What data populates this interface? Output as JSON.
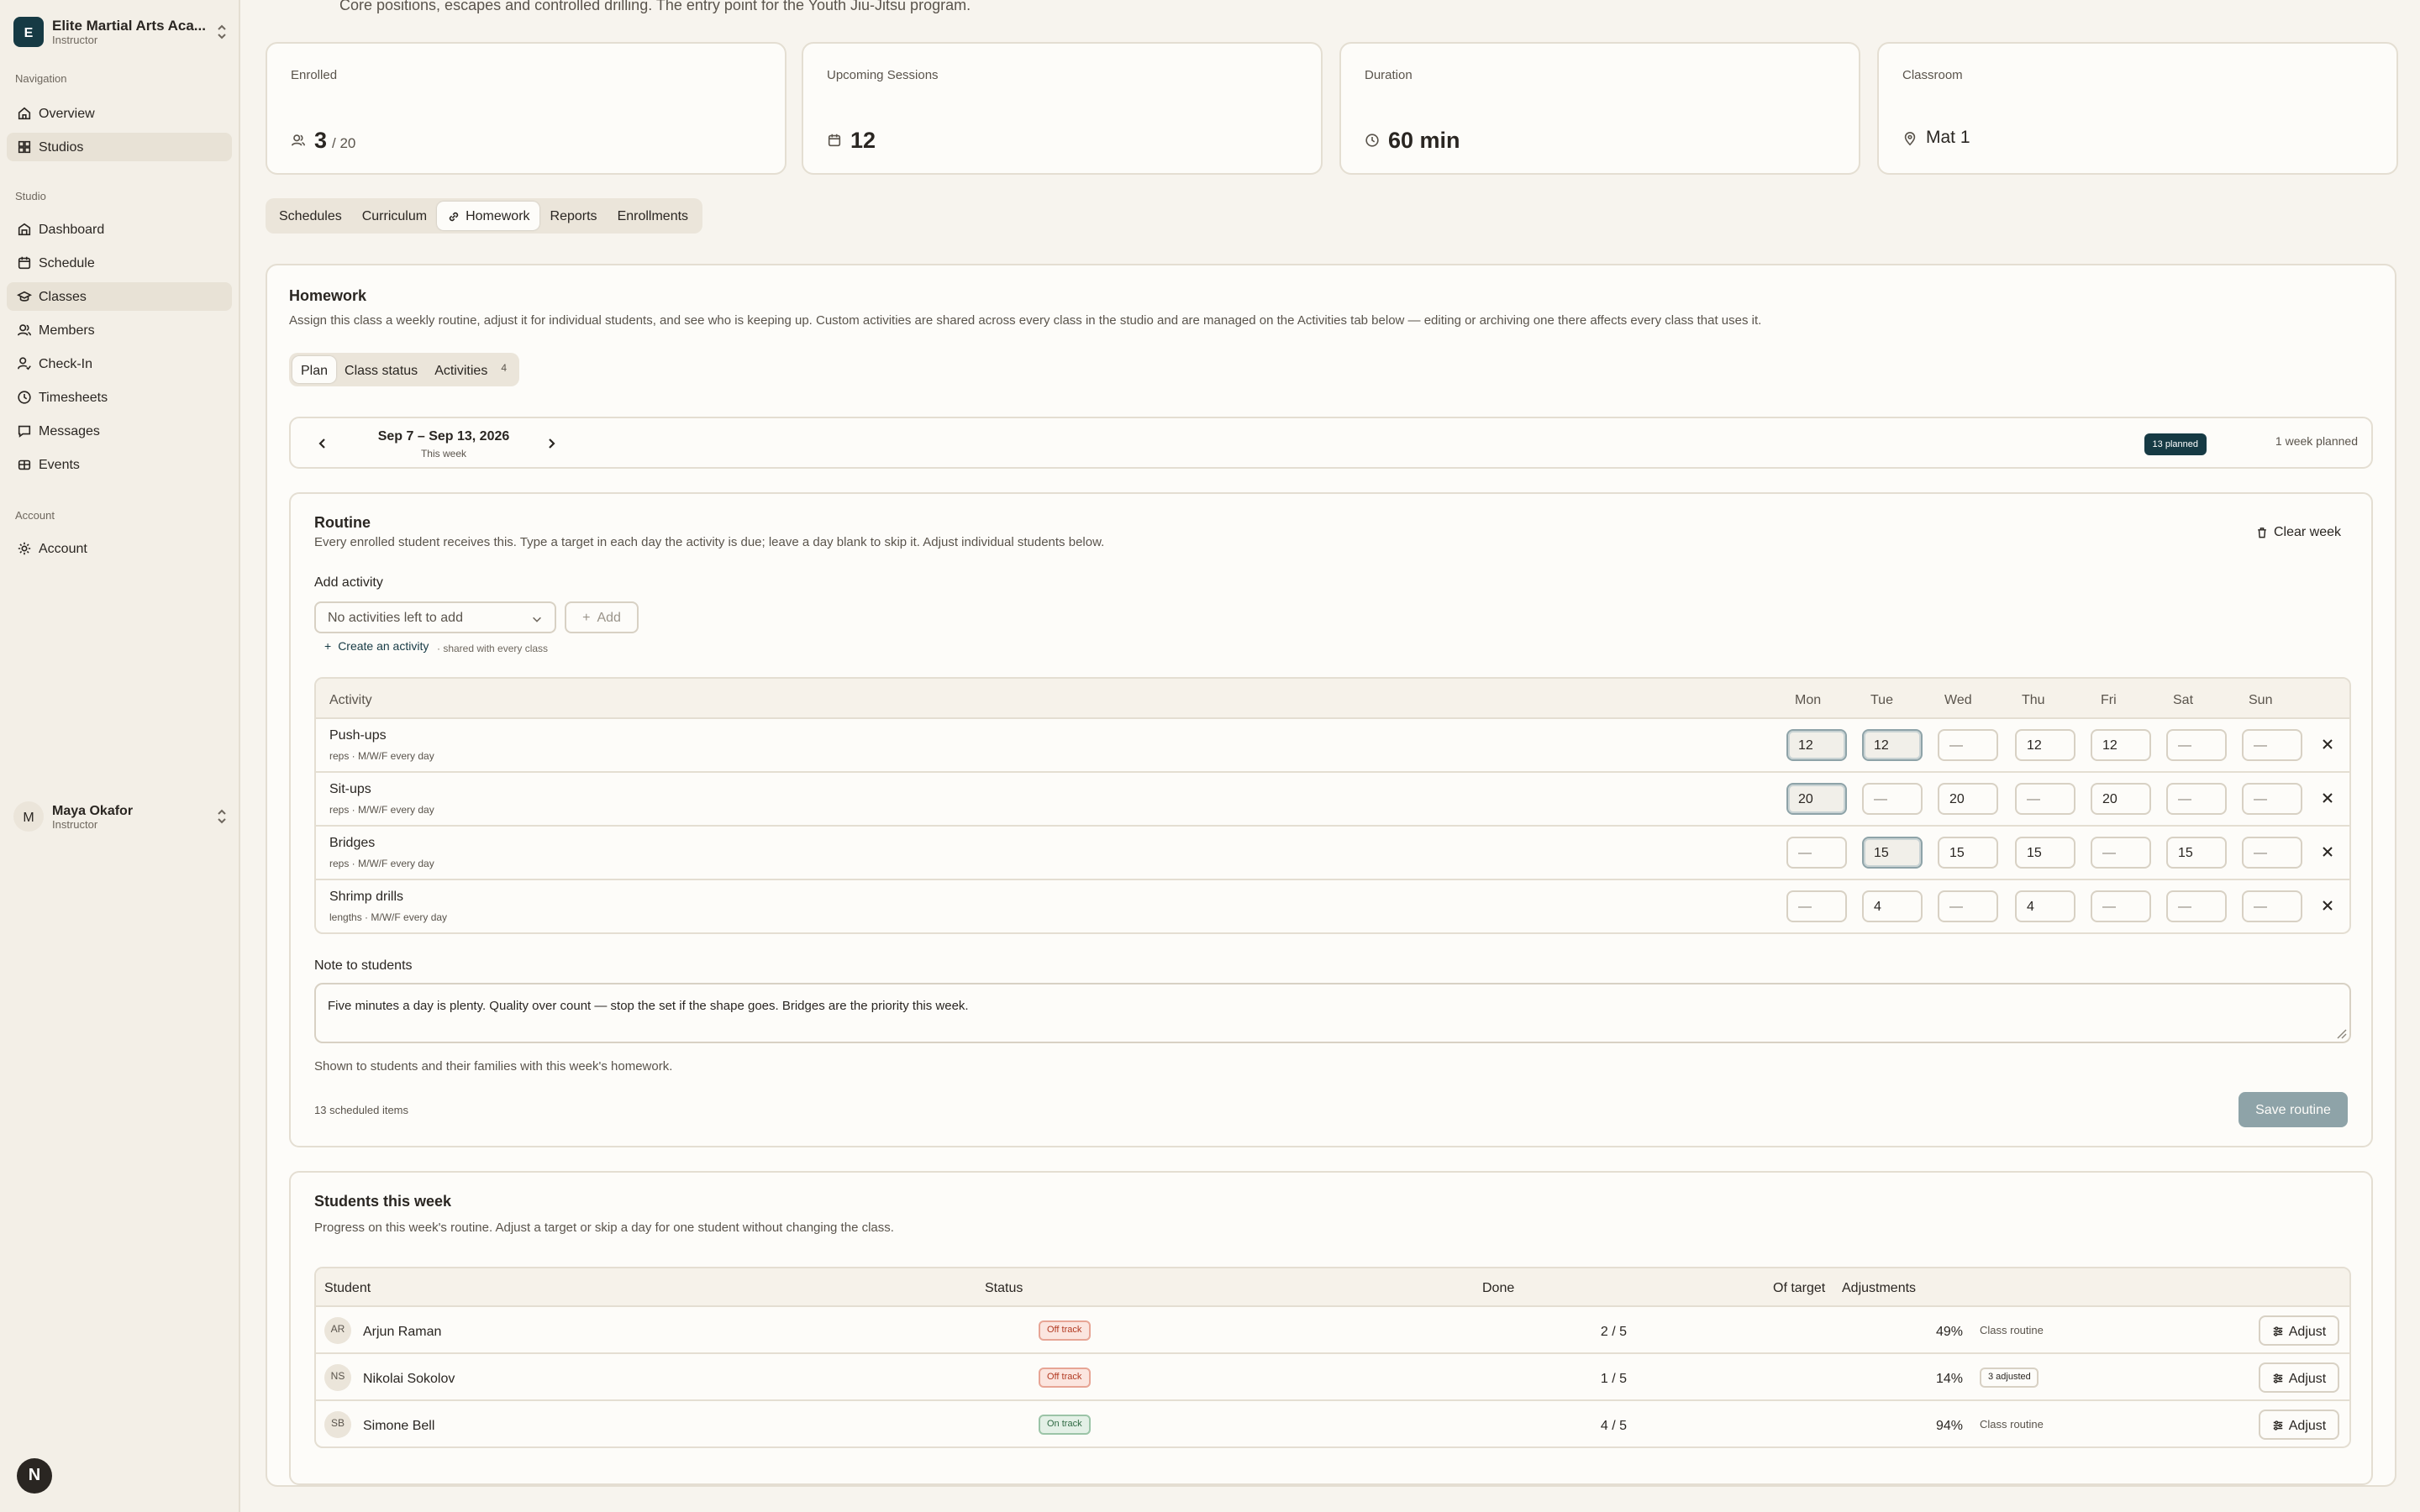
{
  "org": {
    "name": "Elite Martial Arts Aca...",
    "role": "Instructor",
    "logo_letter": "E"
  },
  "sidebar": {
    "section_navigation": "Navigation",
    "section_studio": "Studio",
    "section_account": "Account",
    "nav": [
      {
        "label": "Overview",
        "icon": "home-icon"
      },
      {
        "label": "Studios",
        "icon": "grid-icon"
      }
    ],
    "studio": [
      {
        "label": "Dashboard",
        "icon": "dashboard-icon"
      },
      {
        "label": "Schedule",
        "icon": "calendar-icon"
      },
      {
        "label": "Classes",
        "icon": "classes-icon"
      },
      {
        "label": "Members",
        "icon": "users-icon"
      },
      {
        "label": "Check-In",
        "icon": "check-in-icon"
      },
      {
        "label": "Timesheets",
        "icon": "clock-icon"
      },
      {
        "label": "Messages",
        "icon": "message-icon"
      },
      {
        "label": "Events",
        "icon": "events-icon"
      }
    ],
    "account": [
      {
        "label": "Account",
        "icon": "gear-icon"
      }
    ]
  },
  "user": {
    "name": "Maya Okafor",
    "role": "Instructor",
    "initial": "M"
  },
  "bottom_badge": "N",
  "page": {
    "subtitle": "Core positions, escapes and controlled drilling. The entry point for the Youth Jiu-Jitsu program."
  },
  "stats": {
    "enrolled": {
      "label": "Enrolled",
      "value": "3",
      "total": "/ 20"
    },
    "upcoming": {
      "label": "Upcoming Sessions",
      "value": "12"
    },
    "duration": {
      "label": "Duration",
      "value": "60 min"
    },
    "classroom": {
      "label": "Classroom",
      "value": "Mat 1"
    }
  },
  "tabs": [
    "Schedules",
    "Curriculum",
    "Homework",
    "Reports",
    "Enrollments"
  ],
  "homework": {
    "title": "Homework",
    "description": "Assign this class a weekly routine, adjust it for individual students, and see who is keeping up. Custom activities are shared across every class in the studio and are managed on the Activities tab below — editing or archiving one there affects every class that uses it.",
    "subtabs": {
      "plan": "Plan",
      "class_status": "Class status",
      "activities": "Activities",
      "activities_count": "4"
    },
    "week": {
      "range": "Sep 7 – Sep 13, 2026",
      "sub": "This week",
      "planned_badge": "13 planned",
      "weeks_planned": "1 week planned"
    }
  },
  "routine": {
    "title": "Routine",
    "description": "Every enrolled student receives this. Type a target in each day the activity is due; leave a day blank to skip it. Adjust individual students below.",
    "clear_week": "Clear week",
    "add_activity_label": "Add activity",
    "select_placeholder": "No activities left to add",
    "add_button": "Add",
    "create_link": "Create an activity",
    "shared_note": "· shared with every class",
    "columns": {
      "activity": "Activity",
      "days": [
        "Mon",
        "Tue",
        "Wed",
        "Thu",
        "Fri",
        "Sat",
        "Sun"
      ]
    },
    "activities": [
      {
        "name": "Push-ups",
        "meta": "reps · M/W/F every day",
        "days": [
          "12",
          "12",
          "—",
          "12",
          "12",
          "—",
          "—"
        ],
        "hl": [
          true,
          true,
          false,
          false,
          false,
          false,
          false
        ]
      },
      {
        "name": "Sit-ups",
        "meta": "reps · M/W/F every day",
        "days": [
          "20",
          "—",
          "20",
          "—",
          "20",
          "—",
          "—"
        ],
        "hl": [
          true,
          false,
          false,
          false,
          false,
          false,
          false
        ]
      },
      {
        "name": "Bridges",
        "meta": "reps · M/W/F every day",
        "days": [
          "—",
          "15",
          "15",
          "15",
          "—",
          "15",
          "—"
        ],
        "hl": [
          false,
          true,
          false,
          false,
          false,
          false,
          false
        ]
      },
      {
        "name": "Shrimp drills",
        "meta": "lengths · M/W/F every day",
        "days": [
          "—",
          "4",
          "—",
          "4",
          "—",
          "—",
          "—"
        ],
        "hl": [
          false,
          false,
          false,
          false,
          false,
          false,
          false
        ]
      }
    ],
    "note_label": "Note to students",
    "note_value": "Five minutes a day is plenty. Quality over count — stop the set if the shape goes. Bridges are the priority this week.",
    "note_help": "Shown to students and their families with this week's homework.",
    "scheduled_count": "13 scheduled items",
    "save_button": "Save routine"
  },
  "students": {
    "title": "Students this week",
    "description": "Progress on this week's routine. Adjust a target or skip a day for one student without changing the class.",
    "columns": {
      "student": "Student",
      "status": "Status",
      "done": "Done",
      "of_target": "Of target",
      "adjustments": "Adjustments"
    },
    "rows": [
      {
        "initials": "AR",
        "name": "Arjun Raman",
        "status": "Off track",
        "status_kind": "off",
        "done": "2 / 5",
        "pct": "49%",
        "adjustment": "Class routine",
        "adjustment_pill": false
      },
      {
        "initials": "NS",
        "name": "Nikolai Sokolov",
        "status": "Off track",
        "status_kind": "off",
        "done": "1 / 5",
        "pct": "14%",
        "adjustment": "3 adjusted",
        "adjustment_pill": true
      },
      {
        "initials": "SB",
        "name": "Simone Bell",
        "status": "On track",
        "status_kind": "on",
        "done": "4 / 5",
        "pct": "94%",
        "adjustment": "Class routine",
        "adjustment_pill": false
      }
    ],
    "adjust_button": "Adjust"
  }
}
